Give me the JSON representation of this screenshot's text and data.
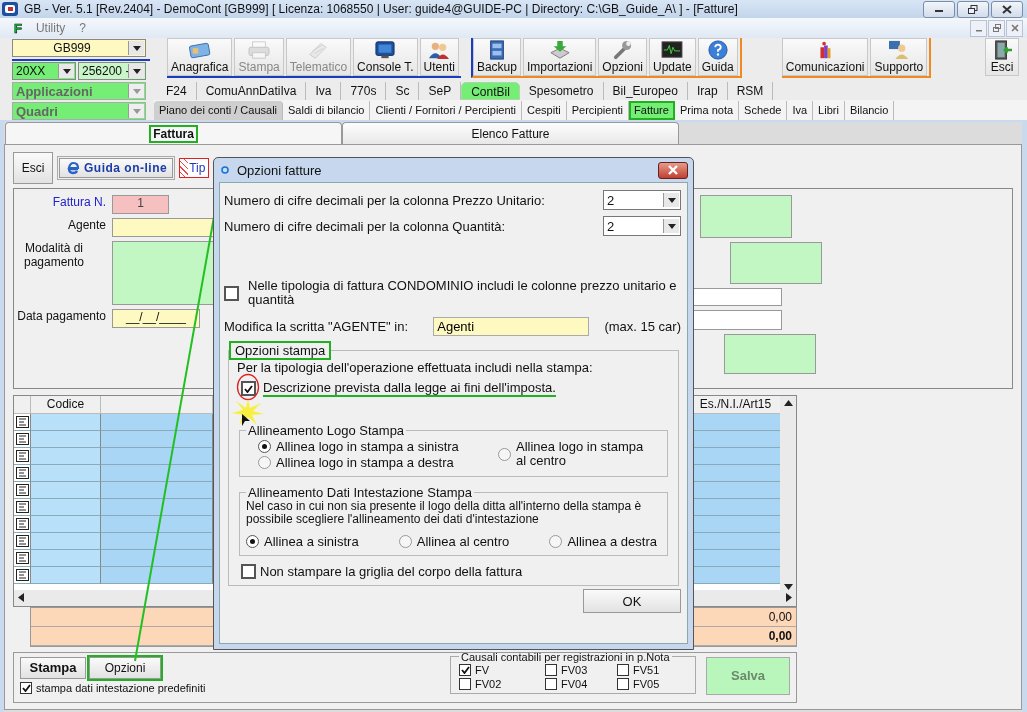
{
  "window": {
    "title": "GB - Ver. 5.1 [Rev.2404] -  DemoCont [GB999]    [ Licenza: 1068550 | User: guide4@GUIDE-PC | Directory: C:\\GB_Guide_A\\ ] - [Fatture]"
  },
  "menu": [
    {
      "label": "F",
      "kind": "logo"
    },
    {
      "label": "Utility",
      "kind": "item"
    },
    {
      "label": "?",
      "kind": "item"
    }
  ],
  "selectors": {
    "company": "GB999",
    "year": "20XX",
    "code": "256200 -",
    "application": "Applicazioni",
    "section": "Quadri"
  },
  "toolbar_groups": [
    [
      {
        "label": "Anagrafica",
        "disabled": false
      },
      {
        "label": "Stampa",
        "disabled": true
      },
      {
        "label": "Telematico",
        "disabled": true
      },
      {
        "label": "Console T.",
        "disabled": false
      },
      {
        "label": "Utenti",
        "disabled": false
      }
    ],
    [
      {
        "label": "Backup",
        "disabled": false
      },
      {
        "label": "Importazioni",
        "disabled": false
      },
      {
        "label": "Opzioni",
        "disabled": false
      },
      {
        "label": "Update",
        "disabled": false
      },
      {
        "label": "Guida",
        "disabled": false
      }
    ],
    [
      {
        "label": "Comunicazioni",
        "disabled": false
      },
      {
        "label": "Supporto",
        "disabled": false
      }
    ],
    [
      {
        "label": "Esci",
        "disabled": false
      }
    ]
  ],
  "module_tabs": [
    {
      "label": "F24",
      "selected": false
    },
    {
      "label": "ComuAnnDatiIva",
      "selected": false
    },
    {
      "label": "Iva",
      "selected": false
    },
    {
      "label": "770s",
      "selected": false
    },
    {
      "label": "Sc",
      "selected": false
    },
    {
      "label": "SeP",
      "selected": false
    },
    {
      "label": "ContBil",
      "selected": true
    },
    {
      "label": "Spesometro",
      "selected": false
    },
    {
      "label": "Bil_Europeo",
      "selected": false
    },
    {
      "label": "Irap",
      "selected": false
    },
    {
      "label": "RSM",
      "selected": false
    }
  ],
  "section_tabs": [
    {
      "label": "Piano dei conti / Causali",
      "selected": false,
      "pressed": true
    },
    {
      "label": "Saldi di bilancio",
      "selected": false,
      "pressed": false
    },
    {
      "label": "Clienti / Fornitori / Percipienti",
      "selected": false,
      "pressed": false
    },
    {
      "label": "Cespiti",
      "selected": false,
      "pressed": false
    },
    {
      "label": "Percipienti",
      "selected": false,
      "pressed": false
    },
    {
      "label": "Fatture",
      "selected": true,
      "pressed": false
    },
    {
      "label": "Prima nota",
      "selected": false,
      "pressed": false
    },
    {
      "label": "Schede",
      "selected": false,
      "pressed": false
    },
    {
      "label": "Iva",
      "selected": false,
      "pressed": false
    },
    {
      "label": "Libri",
      "selected": false,
      "pressed": false
    },
    {
      "label": "Bilancio",
      "selected": false,
      "pressed": false
    }
  ],
  "invoice_tabs": [
    {
      "label": "Fattura",
      "selected": true
    },
    {
      "label": "Elenco Fatture",
      "selected": false
    }
  ],
  "form": {
    "exit_button": "Esci",
    "help_button": "Guida on-line",
    "type_button": "Tip",
    "fields": [
      {
        "label": "Fattura N.",
        "value": "1",
        "kind": "number"
      },
      {
        "label": "Agente",
        "kind": "text"
      },
      {
        "label": "Modalità di pagamento",
        "kind": "memo"
      },
      {
        "label": "Data pagamento",
        "value": "__/__/____",
        "kind": "date"
      }
    ]
  },
  "grid": {
    "columns": [
      "Codice",
      "Es./N.I./Art15"
    ]
  },
  "totals": [
    {
      "value": "0,00",
      "kind": "subtotal"
    },
    {
      "value": "0,00",
      "kind": "total"
    }
  ],
  "footer": {
    "print_button": "Stampa",
    "options_button": "Opzioni",
    "default_header": {
      "label": "stampa dati intestazione predefiniti",
      "checked": true
    },
    "causali": {
      "title": "Causali contabili per registrazioni in p.Nota",
      "items": [
        {
          "label": "FV",
          "checked": true
        },
        {
          "label": "FV02",
          "checked": false
        },
        {
          "label": "FV03",
          "checked": false
        },
        {
          "label": "FV04",
          "checked": false
        },
        {
          "label": "FV51",
          "checked": false
        },
        {
          "label": "FV05",
          "checked": false
        }
      ]
    },
    "save_button": "Salva"
  },
  "dialog": {
    "title": "Opzioni fatture",
    "decimals": [
      {
        "label": "Numero di cifre decimali per la colonna Prezzo Unitario:",
        "value": "2"
      },
      {
        "label": "Numero di cifre decimali per la colonna Quantità:",
        "value": "2"
      }
    ],
    "condominio": {
      "label": "Nelle tipologia di fattura CONDOMINIO includi le colonne prezzo unitario e quantità",
      "checked": false
    },
    "agent": {
      "label": "Modifica la scritta \"AGENTE\" in:",
      "value": "Agenti",
      "hint": "(max. 15 car)"
    },
    "print_options": {
      "title": "Opzioni stampa",
      "intro": "Per la tipologia dell'operazione effettuata includi nella stampa:",
      "description": {
        "label": "Descrizione prevista dalla legge ai fini dell'imposta.",
        "checked": true
      },
      "logo_alignment": {
        "title": "Allineamento Logo Stampa",
        "options": [
          {
            "label": "Allinea logo in stampa a sinistra",
            "selected": true
          },
          {
            "label": "Allinea logo in stampa a destra",
            "selected": false
          },
          {
            "label": "Allinea logo in stampa al centro",
            "selected": false
          }
        ]
      },
      "header_alignment": {
        "title": "Allineamento Dati Intestazione Stampa",
        "note": "Nel caso in cui non sia presente il logo della ditta all'interno della stampa è possibile scegliere l'allineamento dei dati d'intestazione",
        "options": [
          {
            "label": "Allinea a sinistra",
            "selected": true
          },
          {
            "label": "Allinea al centro",
            "selected": false
          },
          {
            "label": "Allinea a destra",
            "selected": false
          }
        ]
      },
      "no_grid": {
        "label": "Non stampare la griglia del corpo della fattura",
        "checked": false
      }
    },
    "ok_button": "OK"
  }
}
